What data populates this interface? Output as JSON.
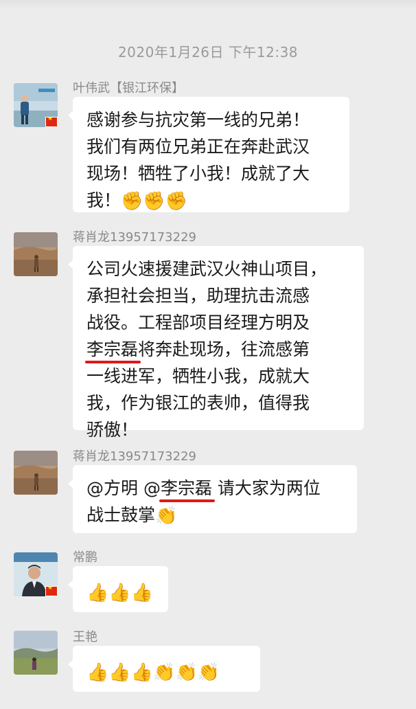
{
  "timestamp": "2020年1月26日 下午12:38",
  "messages": [
    {
      "sender": "叶伟武【银江环保】",
      "lines": [
        "感谢参与抗灾第一线的兄弟！",
        "我们有两位兄弟正在奔赴武汉",
        "现场！牺牲了小我！成就了大"
      ],
      "last_line_text": "我！",
      "emojis": [
        "✊",
        "✊",
        "✊"
      ],
      "avatar_icon": "man-standing-avatar"
    },
    {
      "sender": "蒋肖龙13957173229",
      "lines": [
        "公司火速援建武汉火神山项目，",
        "承担社会担当，助理抗击流感",
        "战役。工程部项目经理方明及"
      ],
      "highlight_name": "李宗磊",
      "highlight_rest": "将奔赴现场，往流感第",
      "lines_after": [
        "一线进军，牺牲小我，成就大",
        "我，作为银江的表帅，值得我",
        "骄傲！"
      ],
      "avatar_icon": "desert-figure-avatar"
    },
    {
      "sender": "蒋肖龙13957173229",
      "mention_1": "@方明",
      "mention_2_at": "@",
      "mention_2_name": "李宗磊",
      "line1_rest": " 请大家为两位",
      "line2": "战士鼓掌",
      "emojis": [
        "👏"
      ],
      "avatar_icon": "desert-figure-avatar"
    },
    {
      "sender": "常鹏",
      "emojis": [
        "👍",
        "👍",
        "👍"
      ],
      "avatar_icon": "man-portrait-avatar"
    },
    {
      "sender": "王艳",
      "emojis": [
        "👍",
        "👍",
        "👍",
        "👏",
        "👏",
        "👏"
      ],
      "avatar_icon": "landscape-avatar"
    }
  ]
}
